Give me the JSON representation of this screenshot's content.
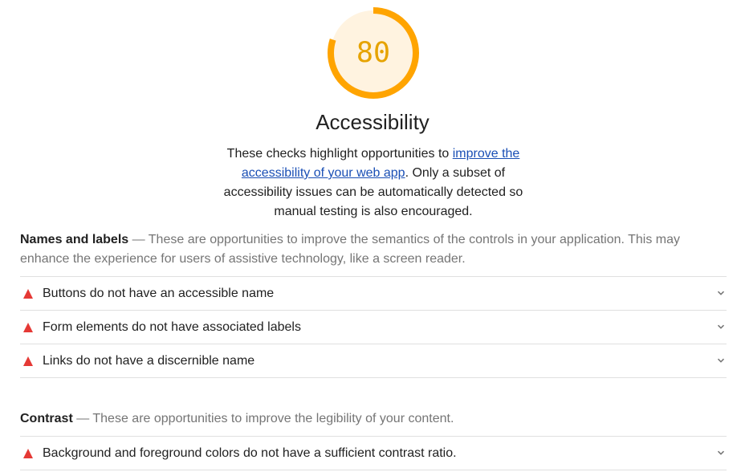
{
  "gauge": {
    "score": "80",
    "score_fraction": 0.8,
    "color": "#ffa400",
    "bg_color": "#fff3e0"
  },
  "category": {
    "title": "Accessibility",
    "desc_before": "These checks highlight opportunities to ",
    "desc_link": "improve the accessibility of your web app",
    "desc_after": ". Only a subset of accessibility issues can be automatically detected so manual testing is also encouraged."
  },
  "groups": [
    {
      "title": "Names and labels",
      "description": " — These are opportunities to improve the semantics of the controls in your application. This may enhance the experience for users of assistive technology, like a screen reader.",
      "audits": [
        {
          "label": "Buttons do not have an accessible name",
          "icon": "fail-triangle-icon"
        },
        {
          "label": "Form elements do not have associated labels",
          "icon": "fail-triangle-icon"
        },
        {
          "label": "Links do not have a discernible name",
          "icon": "fail-triangle-icon"
        }
      ]
    },
    {
      "title": "Contrast",
      "description": " — These are opportunities to improve the legibility of your content.",
      "audits": [
        {
          "label": "Background and foreground colors do not have a sufficient contrast ratio.",
          "icon": "fail-triangle-icon"
        }
      ]
    }
  ],
  "colors": {
    "fail": "#e53935",
    "link": "#1a4fb5",
    "divider": "#e0e0e0"
  }
}
